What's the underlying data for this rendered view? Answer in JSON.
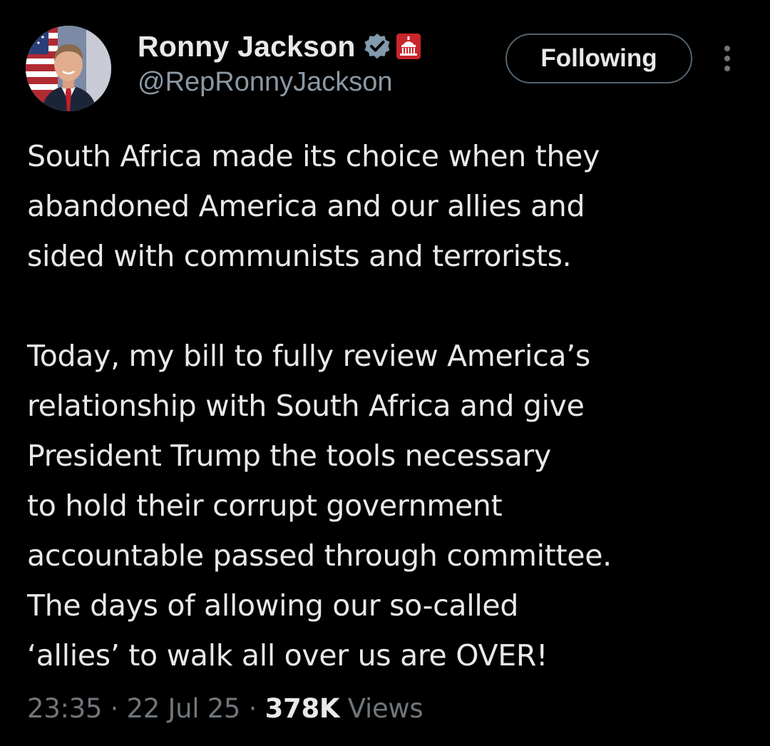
{
  "author": {
    "display_name": "Ronny Jackson",
    "handle": "@RepRonnyJackson",
    "avatar_icon": "profile-photo",
    "verified_icon": "verified-badge-icon",
    "affiliation_icon": "us-capitol-icon"
  },
  "actions": {
    "follow_label": "Following",
    "more_icon": "more-vertical-icon"
  },
  "tweet": {
    "paragraph_1": "South Africa made its choice when they\nabandoned America and our allies and\nsided with communists and terrorists.",
    "paragraph_2": "Today, my bill to fully review America’s\nrelationship with South Africa and give\nPresident Trump the tools necessary\nto hold their corrupt government\naccountable passed through committee.\nThe days of allowing our so-called\n‘allies’ to walk all over us are OVER!"
  },
  "meta": {
    "time": "23:35",
    "separator": "·",
    "date": "22 Jul 25",
    "views_count": "378K",
    "views_label": "Views"
  },
  "colors": {
    "background": "#000000",
    "primary_text": "#e7e9ea",
    "secondary_text": "#71767b",
    "verified_badge": "#829aab",
    "capitol_badge": "#c8252c",
    "button_border": "#536471"
  }
}
